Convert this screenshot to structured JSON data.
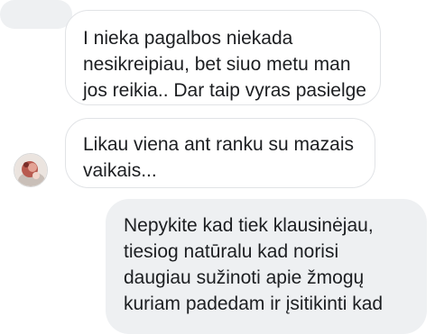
{
  "conversation": {
    "incoming": [
      {
        "lines": [
          "I nieka pagalbos niekada",
          "nesikreipiau, bet siuo metu man",
          "jos reikia.. Dar taip vyras pasielge"
        ]
      },
      {
        "lines": [
          "Likau viena ant ranku su mazais",
          "vaikais..."
        ]
      }
    ],
    "outgoing": [
      {
        "lines": [
          "Nepykite kad tiek klausinėjau,",
          "tiesiog natūralu kad norisi",
          "daugiau sužinoti apie žmogų",
          "kuriam padedam ir įsitikinti kad"
        ]
      }
    ]
  },
  "colors": {
    "incoming_bubble_bg": "#ffffff",
    "incoming_bubble_border": "#e1e3e6",
    "outgoing_bubble_bg": "#eef0f2",
    "text": "#1c1e21"
  },
  "icons": {
    "avatar": "contact-avatar-photo"
  }
}
